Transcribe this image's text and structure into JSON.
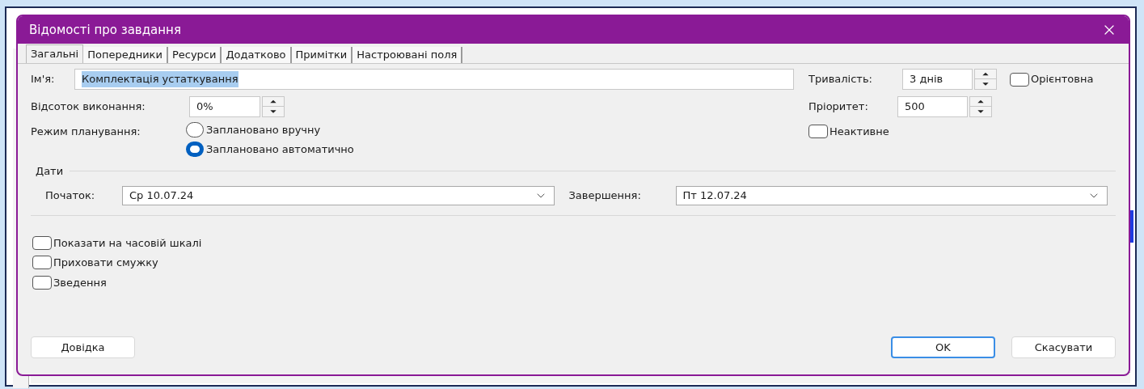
{
  "dialog": {
    "title": "Відомості про завдання",
    "tabs": [
      {
        "label": "Загальні",
        "selected": true
      },
      {
        "label": "Попередники",
        "selected": false
      },
      {
        "label": "Ресурси",
        "selected": false
      },
      {
        "label": "Додатково",
        "selected": false
      },
      {
        "label": "Примітки",
        "selected": false
      },
      {
        "label": "Настроювані поля",
        "selected": false
      }
    ],
    "name": {
      "label": "Ім'я:",
      "value": "Комплектація устаткування",
      "text_selected": true
    },
    "percent_complete": {
      "label": "Відсоток виконання:",
      "value": "0%"
    },
    "scheduling_mode": {
      "label": "Режим планування:",
      "options": [
        {
          "label": "Заплановано вручну",
          "selected": false
        },
        {
          "label": "Заплановано автоматично",
          "selected": true
        }
      ]
    },
    "duration": {
      "label": "Тривалість:",
      "value": "3 днів"
    },
    "estimated": {
      "label": "Орієнтовна",
      "checked": false
    },
    "priority": {
      "label": "Пріоритет:",
      "value": "500"
    },
    "inactive": {
      "label": "Неактивне",
      "checked": false
    },
    "dates": {
      "label": "Дати",
      "start": {
        "label": "Початок:",
        "value": "Ср 10.07.24"
      },
      "finish": {
        "label": "Завершення:",
        "value": "Пт 12.07.24"
      }
    },
    "options": [
      {
        "label": "Показати на часовій шкалі",
        "checked": false
      },
      {
        "label": "Приховати смужку",
        "checked": false
      },
      {
        "label": "Зведення",
        "checked": false
      }
    ],
    "buttons": [
      {
        "label": "Довідка",
        "default": false
      },
      {
        "label": "OK",
        "default": true
      },
      {
        "label": "Скасувати",
        "default": false
      }
    ]
  }
}
